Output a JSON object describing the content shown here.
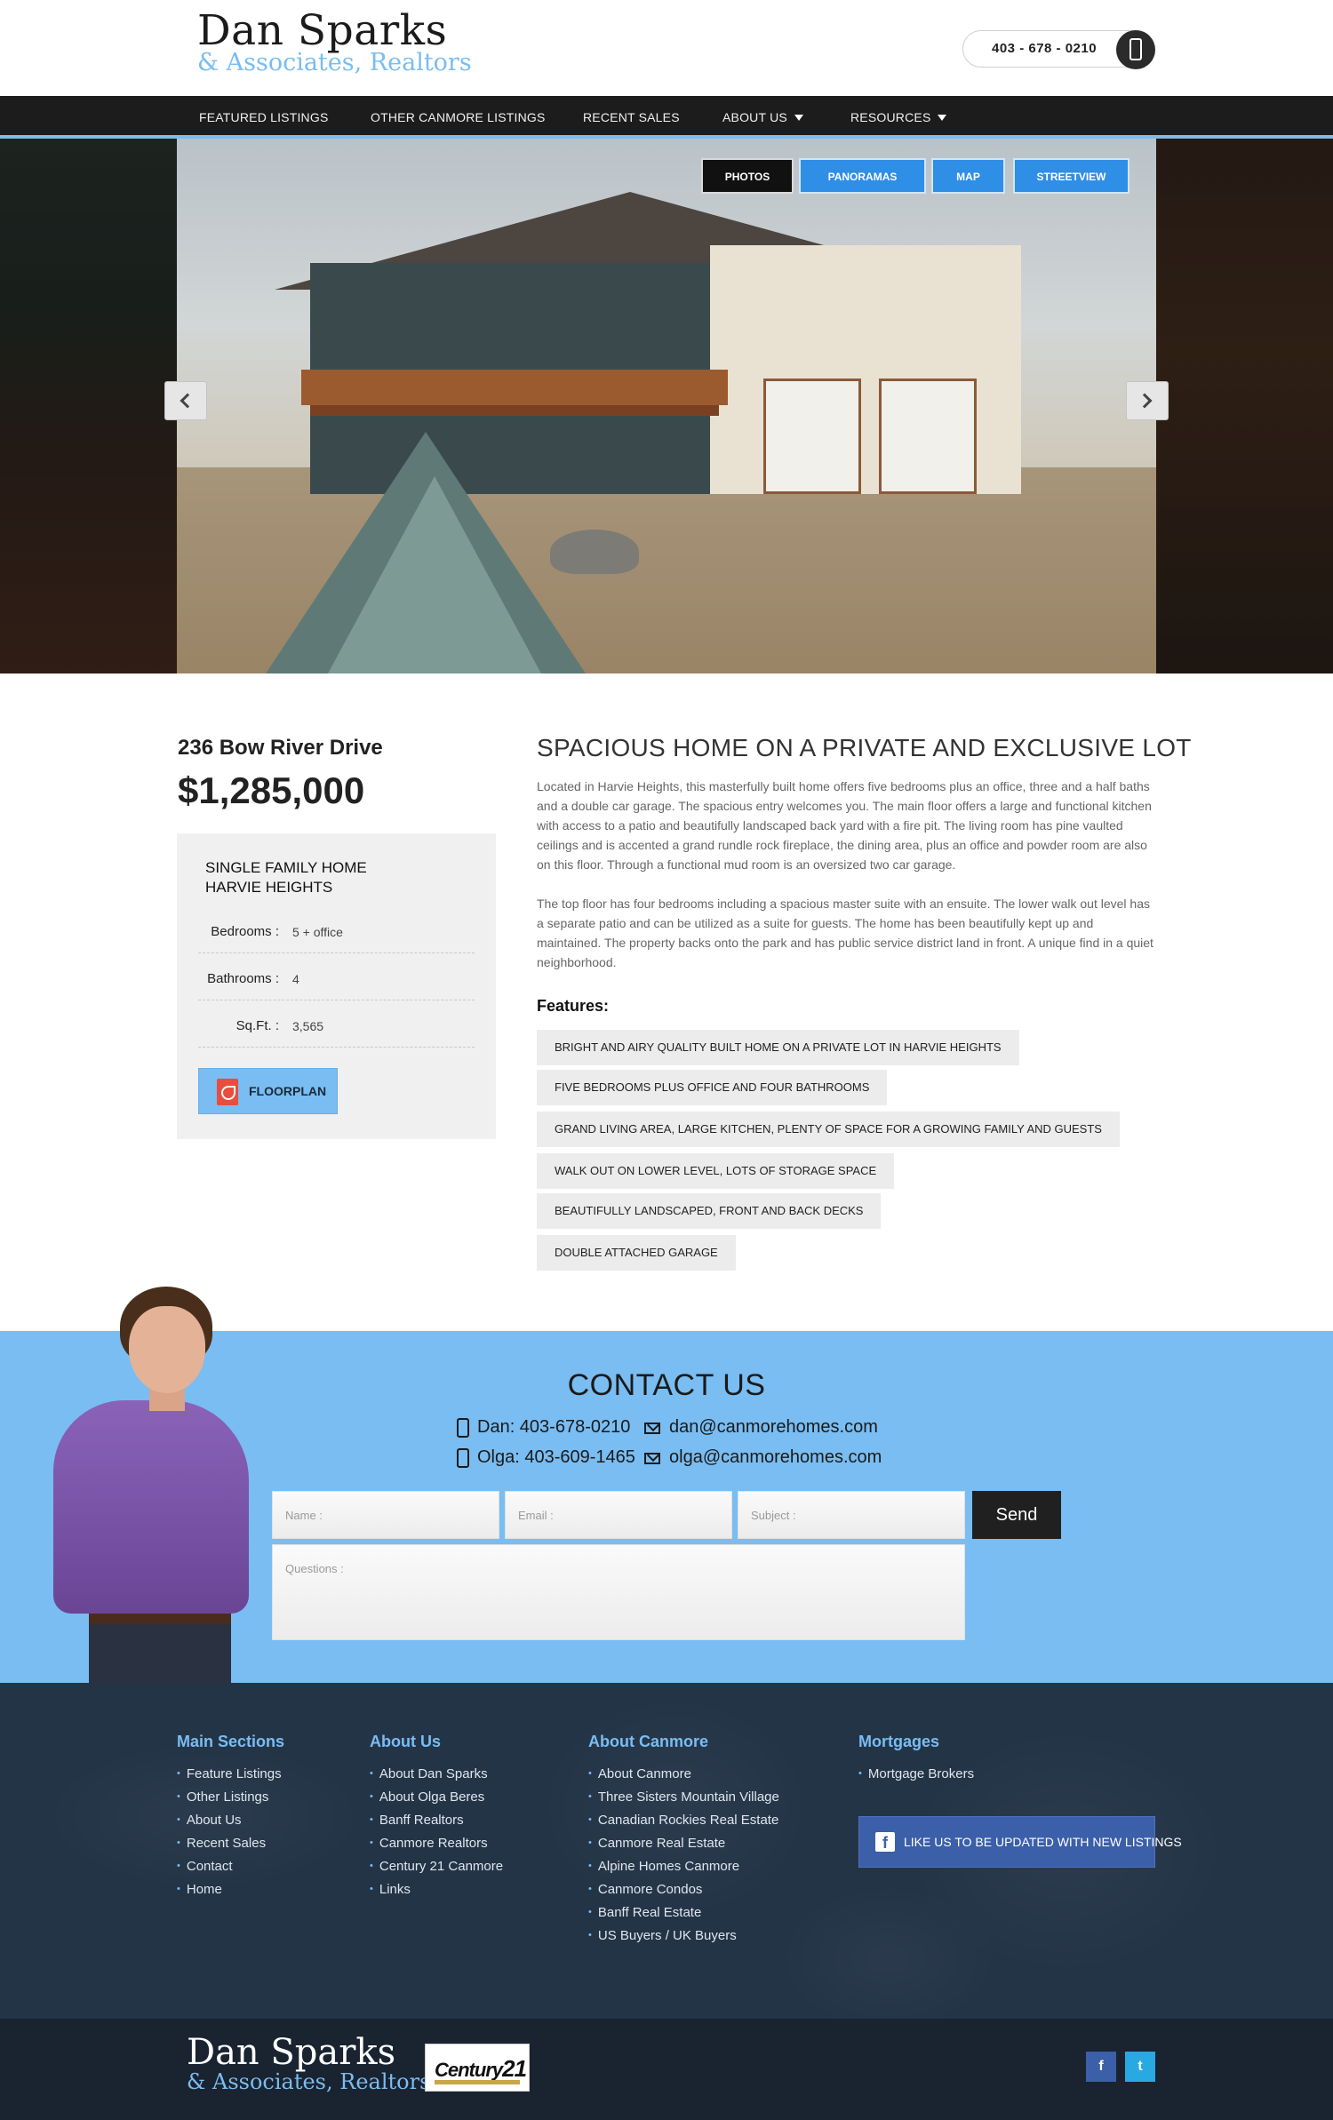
{
  "header": {
    "logo_main": "Dan Sparks",
    "logo_sub": "& Associates, Realtors",
    "phone": "403 - 678 - 0210",
    "phone_icon": "mobile-phone-icon"
  },
  "nav": {
    "items": [
      {
        "label": "FEATURED LISTINGS"
      },
      {
        "label": "OTHER CANMORE LISTINGS"
      },
      {
        "label": "RECENT SALES"
      },
      {
        "label": "ABOUT US",
        "dropdown": true
      },
      {
        "label": "RESOURCES",
        "dropdown": true
      }
    ]
  },
  "hero": {
    "tabs": [
      {
        "label": "PHOTOS",
        "active": true
      },
      {
        "label": "PANORAMAS",
        "active": false
      },
      {
        "label": "MAP",
        "active": false
      },
      {
        "label": "STREETVIEW",
        "active": false
      }
    ],
    "prev_icon": "chevron-left-icon",
    "next_icon": "chevron-right-icon"
  },
  "listing": {
    "address": "236 Bow River Drive",
    "price": "$1,285,000",
    "type": "SINGLE FAMILY HOME",
    "area": "HARVIE HEIGHTS",
    "details": [
      {
        "label": "Bedrooms :",
        "value": "5 + office"
      },
      {
        "label": "Bathrooms :",
        "value": "4"
      },
      {
        "label": "Sq.Ft. :",
        "value": "3,565"
      }
    ],
    "floorplan_label": "FLOORPLAN",
    "title": "SPACIOUS HOME ON A PRIVATE AND EXCLUSIVE LOT",
    "paragraphs": [
      "Located in Harvie Heights, this masterfully built home offers five bedrooms plus an office, three and a half baths and a double car garage. The spacious entry welcomes you. The main floor offers a large and functional kitchen with access to a patio and beautifully landscaped back yard with a fire pit. The living room has pine vaulted ceilings and is accented a grand rundle rock fireplace, the dining area, plus an office and powder room are also on this floor. Through a functional mud room is an oversized two car garage.",
      "The top floor has four bedrooms including a spacious master suite with an ensuite. The lower walk out level has a separate patio and can be utilized as a suite for guests. The home has been beautifully kept up and maintained. The property backs onto the park and has public service district land in front. A unique find in a quiet neighborhood."
    ],
    "features_heading": "Features:",
    "features": [
      "BRIGHT AND AIRY QUALITY BUILT HOME ON A PRIVATE LOT IN HARVIE HEIGHTS",
      "FIVE BEDROOMS PLUS OFFICE AND FOUR BATHROOMS",
      "GRAND LIVING AREA, LARGE KITCHEN, PLENTY OF SPACE FOR A GROWING FAMILY AND GUESTS",
      "WALK OUT ON LOWER LEVEL, LOTS OF STORAGE SPACE",
      "BEAUTIFULLY LANDSCAPED, FRONT AND BACK DECKS",
      "DOUBLE ATTACHED GARAGE"
    ]
  },
  "contact": {
    "title": "CONTACT US",
    "dan_phone": "Dan: 403-678-0210",
    "olga_phone": "Olga: 403-609-1465",
    "dan_email": "dan@canmorehomes.com",
    "olga_email": "olga@canmorehomes.com",
    "name_placeholder": "Name :",
    "email_placeholder": "Email :",
    "subject_placeholder": "Subject :",
    "questions_placeholder": "Questions :",
    "send_label": "Send"
  },
  "footer": {
    "columns": [
      {
        "heading": "Main Sections",
        "links": [
          "Feature Listings",
          "Other Listings",
          "About Us",
          "Recent Sales",
          "Contact",
          "Home"
        ]
      },
      {
        "heading": "About Us",
        "links": [
          "About Dan Sparks",
          "About Olga Beres",
          "Banff Realtors",
          "Canmore Realtors",
          "Century 21 Canmore",
          "Links"
        ]
      },
      {
        "heading": "About Canmore",
        "links": [
          "About Canmore",
          "Three Sisters Mountain Village",
          "Canadian Rockies Real Estate",
          "Canmore Real Estate",
          "Alpine Homes Canmore",
          "Canmore Condos",
          "Banff Real Estate",
          "US Buyers / UK Buyers"
        ]
      },
      {
        "heading": "Mortgages",
        "links": [
          "Mortgage Brokers"
        ]
      }
    ],
    "fb_like": "LIKE US TO BE UPDATED WITH NEW LISTINGS",
    "logo_main": "Dan Sparks",
    "logo_sub": "& Associates, Realtors",
    "c21_logo": "Century21",
    "social": [
      {
        "icon": "facebook-icon",
        "glyph": "f",
        "color": "#3b5fa8"
      },
      {
        "icon": "twitter-icon",
        "glyph": "t",
        "color": "#29a9e1"
      }
    ]
  },
  "colors": {
    "accent": "#79bdf2",
    "nav_bg": "#1c1c1c",
    "footer_bg": "#243447",
    "tab_blue": "#2f8ee6"
  }
}
